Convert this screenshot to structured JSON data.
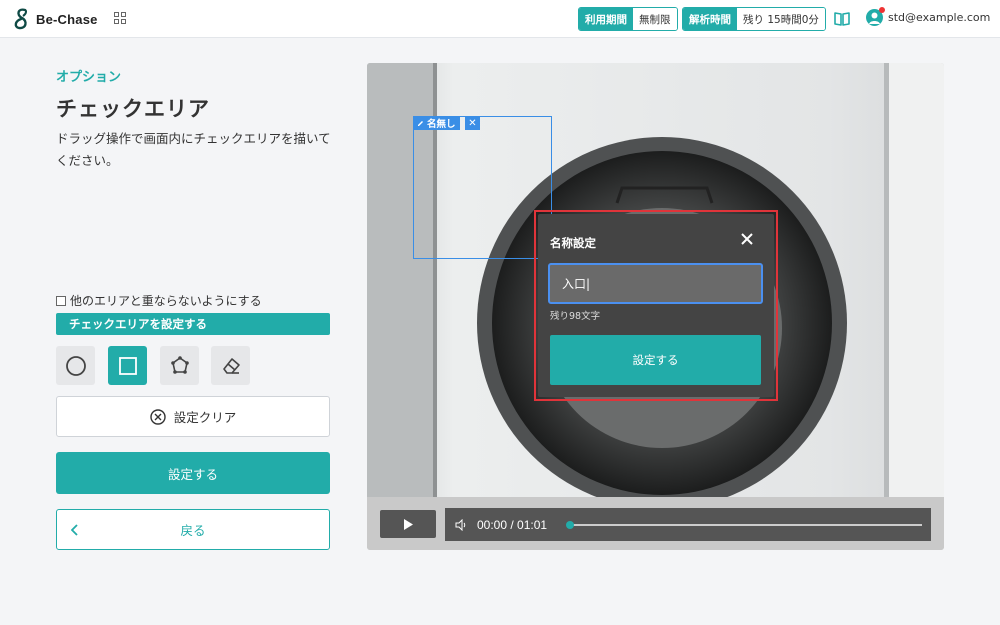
{
  "header": {
    "logo_text": "Be-Chase",
    "usage_period": {
      "label": "利用期間",
      "value": "無制限"
    },
    "analysis_time": {
      "label": "解析時間",
      "value": "残り 15時間0分"
    },
    "user_email": "std@example.com"
  },
  "sidebar": {
    "subtitle": "オプション",
    "title": "チェックエリア",
    "description": "ドラッグ操作で画面内にチェックエリアを描いてください。",
    "no_overlap_label": "他のエリアと重ならないようにする",
    "no_overlap_checked": false,
    "section_label": "チェックエリアを設定する",
    "tools": [
      {
        "name": "circle",
        "active": false
      },
      {
        "name": "rectangle",
        "active": true
      },
      {
        "name": "polygon",
        "active": false
      },
      {
        "name": "eraser",
        "active": false
      }
    ],
    "clear_label": "設定クリア",
    "set_label": "設定する",
    "back_label": "戻る"
  },
  "video": {
    "time": "00:00 / 01:01",
    "progress": 0.0,
    "area": {
      "tag": "名無し",
      "close": "✕"
    }
  },
  "dialog": {
    "title": "名称設定",
    "input_value": "入口|",
    "remaining": "残り98文字",
    "submit_label": "設定する"
  },
  "colors": {
    "accent": "#22aca9",
    "area": "#3a8ee6",
    "highlight": "#e0343a"
  }
}
